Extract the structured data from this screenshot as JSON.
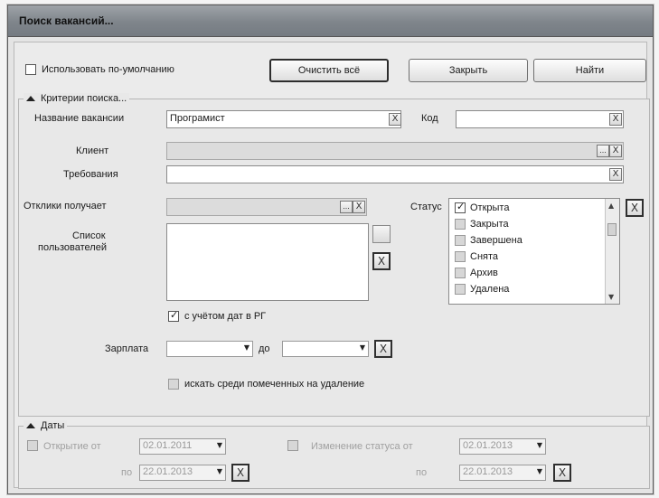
{
  "window": {
    "title": "Поиск вакансий..."
  },
  "top": {
    "use_default_label": "Использовать по-умолчанию",
    "use_default_checked": false,
    "clear_all_label": "Очистить всё",
    "close_label": "Закрыть",
    "find_label": "Найти"
  },
  "criteria": {
    "header": "Критерии поиска...",
    "vacancy_name_label": "Название вакансии",
    "vacancy_name_value": "Програмист",
    "code_label": "Код",
    "code_value": "",
    "client_label": "Клиент",
    "client_value": "",
    "requirements_label": "Требования",
    "requirements_value": "",
    "recipient_label": "Отклики получает",
    "recipient_value": "",
    "users_list_label_1": "Список",
    "users_list_label_2": "пользователей",
    "consider_dates_label": "с учётом дат в РГ",
    "consider_dates_checked": true,
    "salary_label": "Зарплата",
    "salary_from": "",
    "salary_to_label": "до",
    "salary_to": "",
    "search_deleted_label": "искать среди помеченных на удаление",
    "search_deleted_checked": false,
    "status_label": "Статус",
    "status_items": [
      {
        "label": "Открыта",
        "checked": true
      },
      {
        "label": "Закрыта",
        "checked": false
      },
      {
        "label": "Завершена",
        "checked": false
      },
      {
        "label": "Снята",
        "checked": false
      },
      {
        "label": "Архив",
        "checked": false
      },
      {
        "label": "Удалена",
        "checked": false
      }
    ]
  },
  "dates": {
    "header": "Даты",
    "opening_label": "Открытие от",
    "opening_from": "02.01.2011",
    "opening_to_label": "по",
    "opening_to": "22.01.2013",
    "change_label": "Изменение статуса от",
    "change_from": "02.01.2013",
    "change_to_label": "по",
    "change_to": "22.01.2013"
  },
  "icons": {
    "clear": "X",
    "browse": "...",
    "dropdown": "▼",
    "collapse": "▲"
  }
}
